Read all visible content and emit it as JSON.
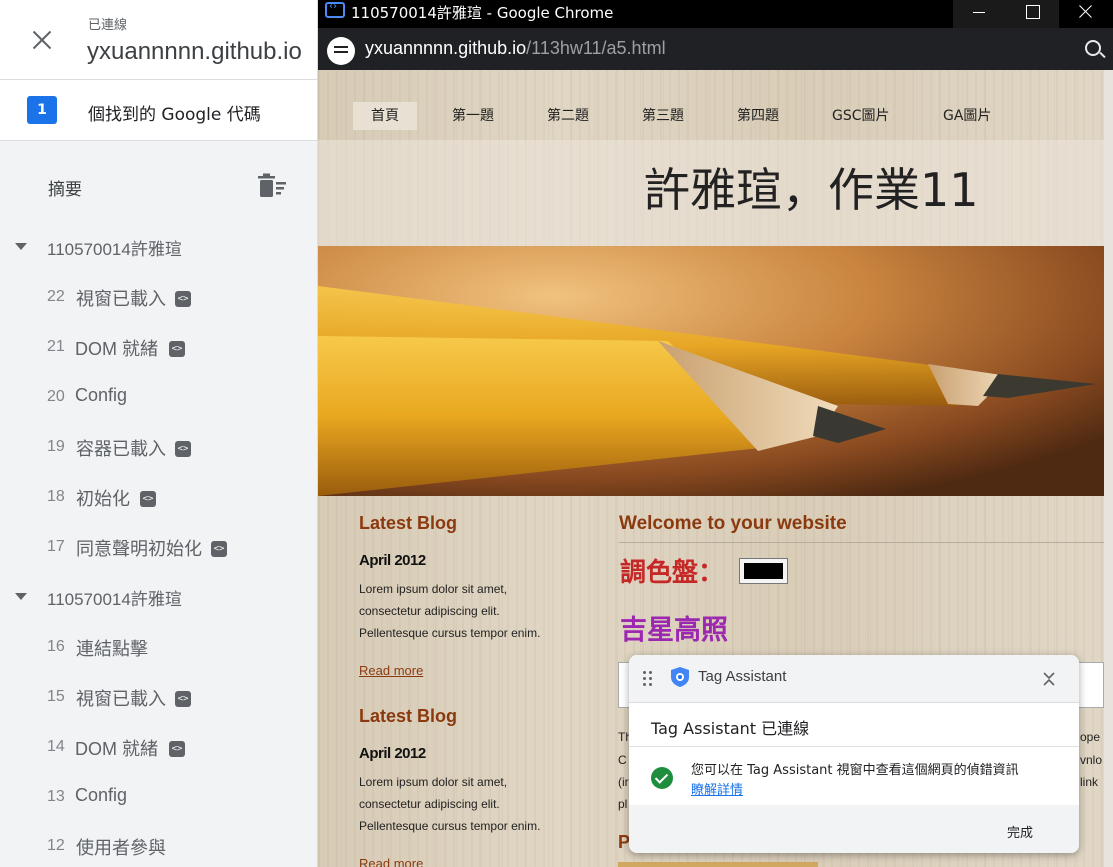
{
  "panel": {
    "status": "已連線",
    "domain": "yxuannnnn.github.io",
    "tag_count": "1",
    "tag_text": "個找到的 Google 代碼",
    "summary_label": "摘要",
    "groups": [
      {
        "label": "110570014許雅瑄",
        "events": [
          {
            "num": "22",
            "label": "視窗已載入",
            "code": true
          },
          {
            "num": "21",
            "label": "DOM 就緒",
            "code": true
          },
          {
            "num": "20",
            "label": "Config",
            "code": false
          },
          {
            "num": "19",
            "label": "容器已載入",
            "code": true
          },
          {
            "num": "18",
            "label": "初始化",
            "code": true
          },
          {
            "num": "17",
            "label": "同意聲明初始化",
            "code": true
          }
        ]
      },
      {
        "label": "110570014許雅瑄",
        "events": [
          {
            "num": "16",
            "label": "連結點擊",
            "code": false
          },
          {
            "num": "15",
            "label": "視窗已載入",
            "code": true
          },
          {
            "num": "14",
            "label": "DOM 就緒",
            "code": true
          },
          {
            "num": "13",
            "label": "Config",
            "code": false
          },
          {
            "num": "12",
            "label": "使用者參與",
            "code": false
          }
        ]
      }
    ]
  },
  "chrome": {
    "window_title": "110570014許雅瑄 - Google Chrome",
    "url_host": "yxuannnnn.github.io",
    "url_path": "/113hw11/a5.html"
  },
  "site": {
    "nav": [
      "首頁",
      "第一題",
      "第二題",
      "第三題",
      "第四題",
      "GSC圖片",
      "GA圖片"
    ],
    "title": "許雅瑄，作業11",
    "blog": [
      {
        "title": "Latest Blog",
        "date": "April 2012",
        "body": "Lorem ipsum dolor sit amet, consectetur adipiscing elit. Pellentesque cursus tempor enim.",
        "more": "Read more"
      },
      {
        "title": "Latest Blog",
        "date": "April 2012",
        "body": "Lorem ipsum dolor sit amet, consectetur adipiscing elit. Pellentesque cursus tempor enim.",
        "more": "Read more"
      }
    ],
    "welcome": "Welcome to your website",
    "palette_label": "調色盤：",
    "lucky_text": "吉星高照",
    "para_left": [
      "Th",
      "C",
      "(ir",
      "pl"
    ],
    "para_right": [
      "ope",
      "vnlo",
      "link",
      ""
    ],
    "heading_partial": "P"
  },
  "popup": {
    "title": "Tag Assistant",
    "status": "Tag Assistant 已連線",
    "message": "您可以在 Tag Assistant 視窗中查看這個網頁的偵錯資訊",
    "link": "瞭解詳情",
    "done": "完成"
  }
}
